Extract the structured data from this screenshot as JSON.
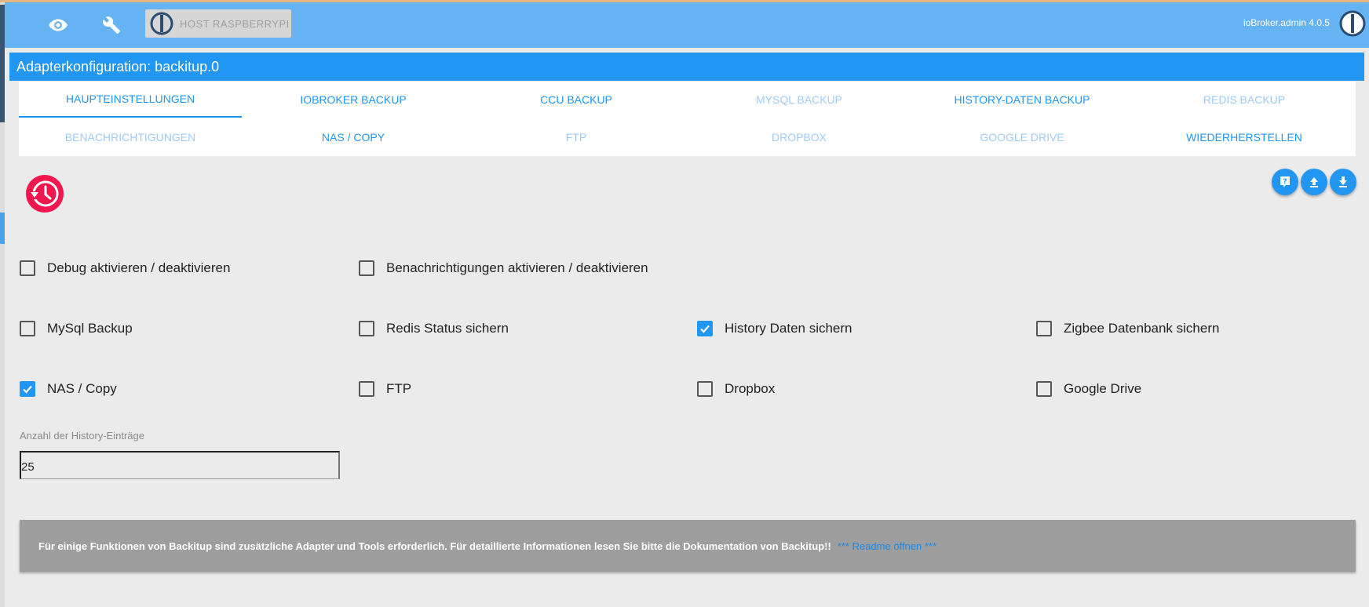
{
  "header": {
    "host_label": "HOST RASPBERRYPI",
    "version": "ioBroker.admin 4.0.5",
    "icons": [
      "eye-icon",
      "wrench-icon",
      "iobroker-logo-icon"
    ]
  },
  "title": "Adapterkonfiguration: backitup.0",
  "tabs": [
    {
      "label": "Haupteinstellungen",
      "state": "active"
    },
    {
      "label": "ioBroker Backup",
      "state": "enabled"
    },
    {
      "label": "CCU Backup",
      "state": "enabled"
    },
    {
      "label": "MySQL Backup",
      "state": "disabled"
    },
    {
      "label": "History-Daten Backup",
      "state": "enabled"
    },
    {
      "label": "Redis Backup",
      "state": "disabled"
    },
    {
      "label": "Benachrichtigungen",
      "state": "disabled"
    },
    {
      "label": "NAS / Copy",
      "state": "enabled"
    },
    {
      "label": "FTP",
      "state": "disabled"
    },
    {
      "label": "Dropbox",
      "state": "disabled"
    },
    {
      "label": "Google Drive",
      "state": "disabled"
    },
    {
      "label": "Wiederherstellen",
      "state": "enabled"
    }
  ],
  "actions": [
    "help-icon",
    "upload-icon",
    "download-icon"
  ],
  "options": [
    {
      "label": "Debug aktivieren / deaktivieren",
      "checked": false
    },
    {
      "label": "Benachrichtigungen aktivieren / deaktivieren",
      "checked": false
    },
    {
      "label": "MySql Backup",
      "checked": false
    },
    {
      "label": "Redis Status sichern",
      "checked": false
    },
    {
      "label": "History Daten sichern",
      "checked": true
    },
    {
      "label": "Zigbee Datenbank sichern",
      "checked": false
    },
    {
      "label": "NAS / Copy",
      "checked": true
    },
    {
      "label": "FTP",
      "checked": false
    },
    {
      "label": "Dropbox",
      "checked": false
    },
    {
      "label": "Google Drive",
      "checked": false
    }
  ],
  "history_field": {
    "label": "Anzahl der History-Einträge",
    "value": "25"
  },
  "info": {
    "text": "Für einige Funktionen von Backitup sind zusätzliche Adapter und Tools erforderlich. Für detaillierte Informationen lesen Sie bitte die Dokumentation von Backitup!!",
    "link": "*** Readme öffnen ***"
  },
  "colors": {
    "header": "#66b3f4",
    "accent": "#2196f3",
    "adapter_logo": "#f0174f",
    "info_bg": "#9e9e9e"
  }
}
